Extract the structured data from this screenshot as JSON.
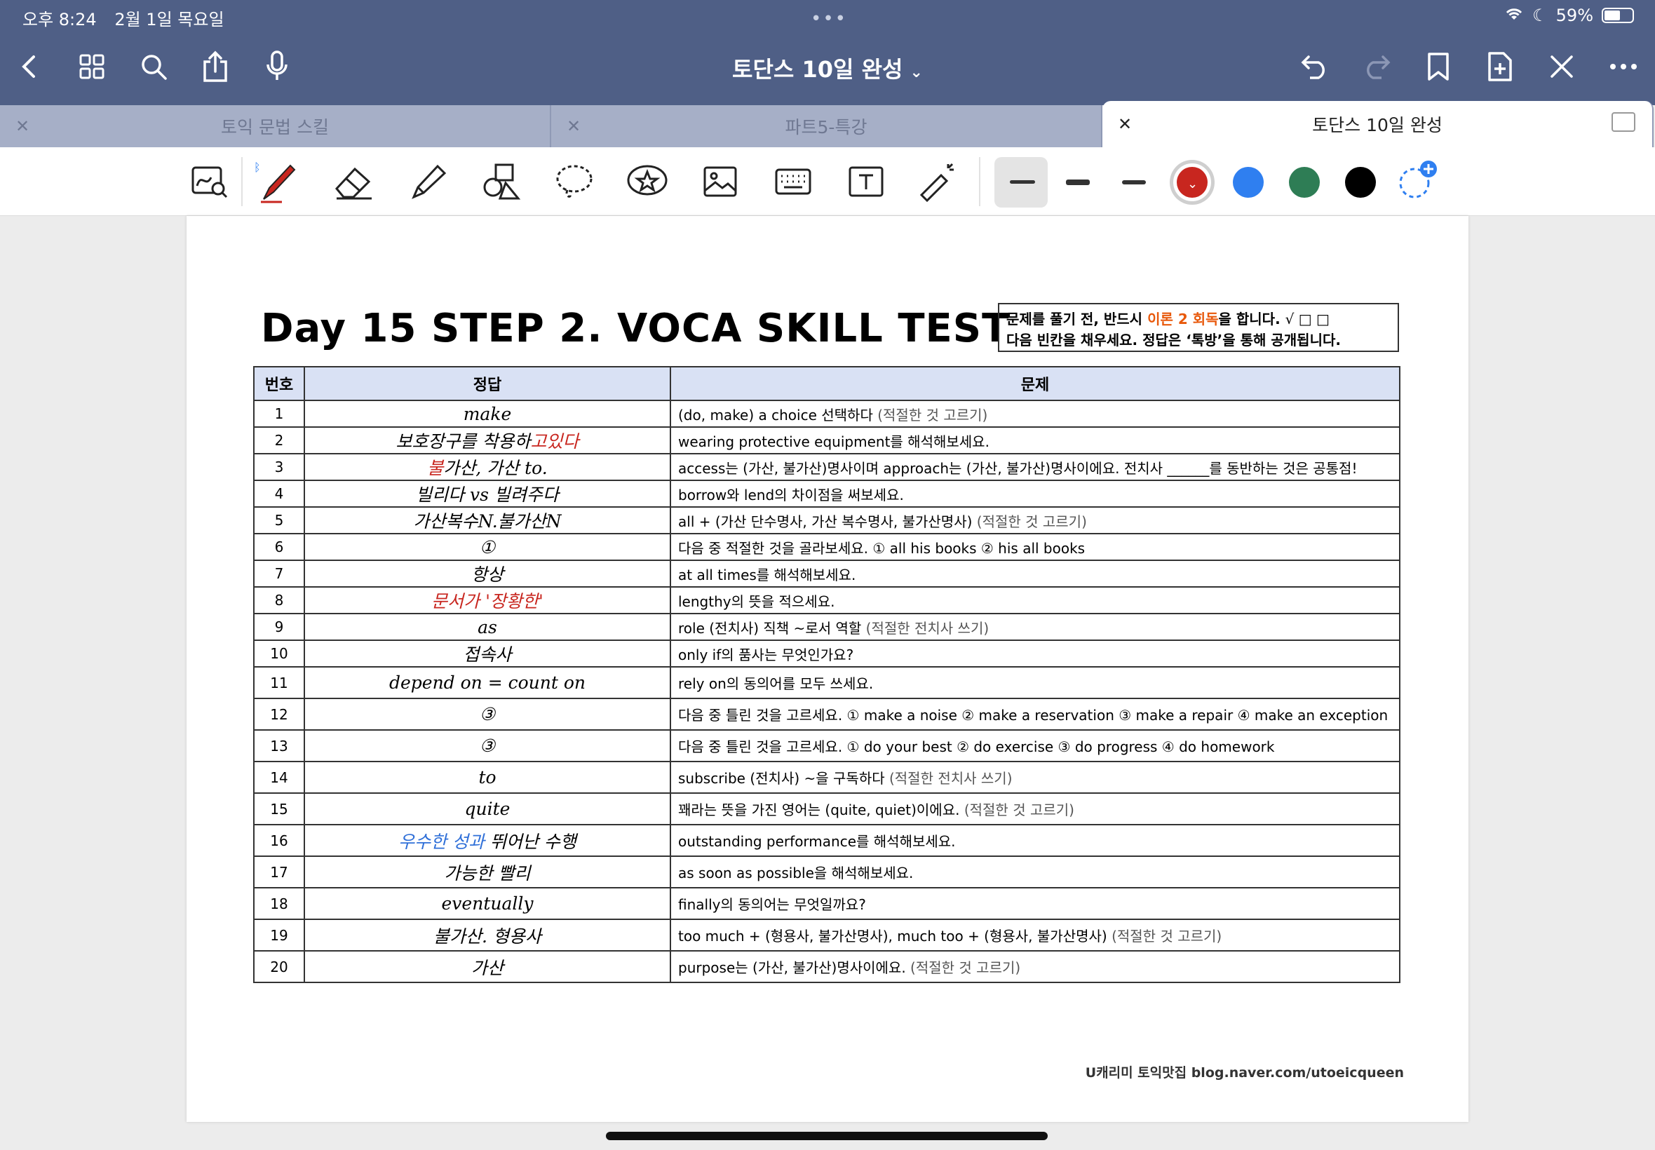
{
  "status_bar": {
    "time": "오후 8:24",
    "date": "2월 1일 목요일",
    "battery": "59%",
    "battery_level": 0.59
  },
  "nav": {
    "title": "토단스 10일 완성"
  },
  "tabs": [
    {
      "label": "토익 문법 스킬",
      "active": false
    },
    {
      "label": "파트5-특강",
      "active": false
    },
    {
      "label": "토단스 10일 완성",
      "active": true
    }
  ],
  "toolbar": {
    "colors": [
      "#c8261f",
      "#2f7ff0",
      "#2e7d55",
      "#000000"
    ],
    "selected_color": "#c8261f"
  },
  "page": {
    "title": "Day 15 STEP 2. VOCA SKILL TEST",
    "notice": {
      "line1_a": "문제를 풀기 전, 반드시 ",
      "line1_b": "이론 2 회독",
      "line1_c": "을 합니다.",
      "checks": "√ □ □",
      "line2": "다음 빈칸을 채우세요. 정답은 ‘톡방’을 통해 공개됩니다."
    },
    "headers": {
      "num": "번호",
      "answer": "정답",
      "question": "문제"
    },
    "rows": [
      {
        "num": "1",
        "answer": "make",
        "question": "(do, make) a choice 선택하다",
        "hint": "(적절한 것 고르기)"
      },
      {
        "num": "2",
        "answer": "보호장구를 착용하",
        "answer_red": "고있다",
        "question": "wearing protective equipment를 해석해보세요."
      },
      {
        "num": "3",
        "answer": "가산, 가산      to.",
        "answer_red": "불",
        "question": "access는 (가산, 불가산)명사이며 approach는 (가산, 불가산)명사이에요. 전치사 ______를 동반하는 것은 공통점!"
      },
      {
        "num": "4",
        "answer": "빌리다 vs 빌려주다",
        "question": "borrow와 lend의 차이점을 써보세요."
      },
      {
        "num": "5",
        "answer": "가산복수N.불가산N",
        "question": "all + (가산 단수명사, 가산 복수명사, 불가산명사)",
        "hint": "(적절한 것 고르기)"
      },
      {
        "num": "6",
        "answer": "①",
        "question": "다음 중 적절한 것을 골라보세요. ① all his books  ② his all books"
      },
      {
        "num": "7",
        "answer": "항상",
        "question": "at all times를 해석해보세요."
      },
      {
        "num": "8",
        "answer_red": "문서가 '장황한'",
        "question": "lengthy의 뜻을 적으세요."
      },
      {
        "num": "9",
        "answer": "as",
        "question": "role (전치사) 직책 ~로서 역할",
        "hint": "(적절한 전치사 쓰기)"
      },
      {
        "num": "10",
        "answer": "접속사",
        "question": "only if의 품사는 무엇인가요?"
      },
      {
        "num": "11",
        "answer": "depend on = count on",
        "question": "rely on의 동의어를 모두 쓰세요."
      },
      {
        "num": "12",
        "answer": "③",
        "question": "다음 중 틀린 것을 고르세요. ① make a noise ② make a reservation ③ make a repair ④ make an exception"
      },
      {
        "num": "13",
        "answer": "③",
        "question": "다음 중 틀린 것을 고르세요. ① do your best ② do exercise ③ do progress ④ do homework"
      },
      {
        "num": "14",
        "answer": "to",
        "question": "subscribe (전치사) ~을 구독하다",
        "hint": "(적절한 전치사 쓰기)"
      },
      {
        "num": "15",
        "answer": "quite",
        "question": "꽤라는 뜻을 가진 영어는 (quite, quiet)이에요.",
        "hint": "(적절한 것 고르기)"
      },
      {
        "num": "16",
        "answer_blue": "우수한 성과",
        "answer": " 뛰어난 수행",
        "question": "outstanding performance를 해석해보세요."
      },
      {
        "num": "17",
        "answer": "가능한 빨리",
        "question": "as soon as possible을 해석해보세요."
      },
      {
        "num": "18",
        "answer": "eventually",
        "question": "finally의 동의어는 무엇일까요?"
      },
      {
        "num": "19",
        "answer": "불가산. 형용사",
        "question": "too much + (형용사, 불가산명사), much too + (형용사, 불가산명사)",
        "hint": "(적절한 것 고르기)"
      },
      {
        "num": "20",
        "answer": "가산",
        "question": "purpose는 (가산, 불가산)명사이에요.",
        "hint": "(적절한 것 고르기)"
      }
    ],
    "footer": "U캐리미 토익맛집 blog.naver.com/utoeicqueen"
  }
}
